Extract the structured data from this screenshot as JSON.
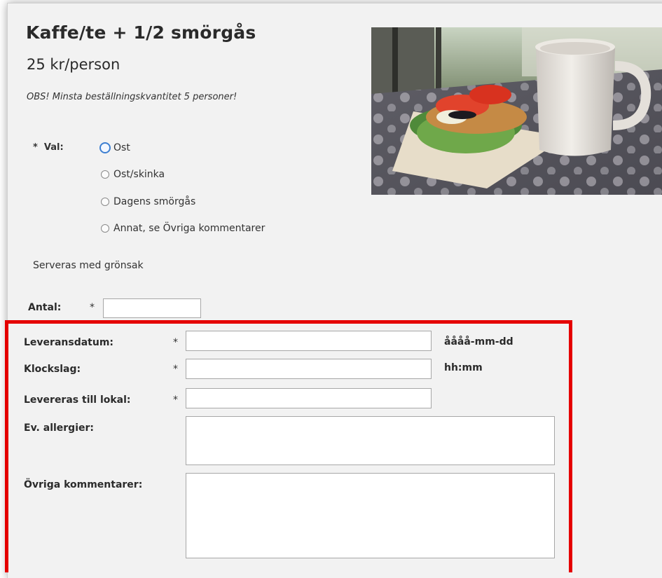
{
  "product": {
    "title": "Kaffe/te + 1/2 smörgås",
    "price": "25 kr/person",
    "notice": "OBS! Minsta beställningskvantitet 5 personer!"
  },
  "choice": {
    "required_mark": "*",
    "label": "Val:",
    "options": [
      {
        "label": "Ost",
        "selected": false,
        "focused": true
      },
      {
        "label": "Ost/skinka",
        "selected": false
      },
      {
        "label": "Dagens smörgås",
        "selected": false
      },
      {
        "label": "Annat, se Övriga kommentarer",
        "selected": false
      }
    ]
  },
  "served_with": "Serveras med grönsak",
  "form": {
    "antal_label": "Antal:",
    "antal_value": "",
    "required_mark": "*",
    "leveransdatum_label": "Leveransdatum:",
    "leveransdatum_value": "",
    "leveransdatum_hint": "åååå-mm-dd",
    "klockslag_label": "Klockslag:",
    "klockslag_value": "",
    "klockslag_hint": "hh:mm",
    "lokal_label": "Levereras till lokal:",
    "lokal_value": "",
    "allergier_label": "Ev. allergier:",
    "allergier_value": "",
    "kommentarer_label": "Övriga kommentarer:",
    "kommentarer_value": ""
  },
  "colors": {
    "highlight_border": "#e50000",
    "focus_ring": "#3d7fd1",
    "panel_background": "#f2f2f2"
  },
  "image": {
    "subject": "coffee mug and open sandwich on a table"
  }
}
